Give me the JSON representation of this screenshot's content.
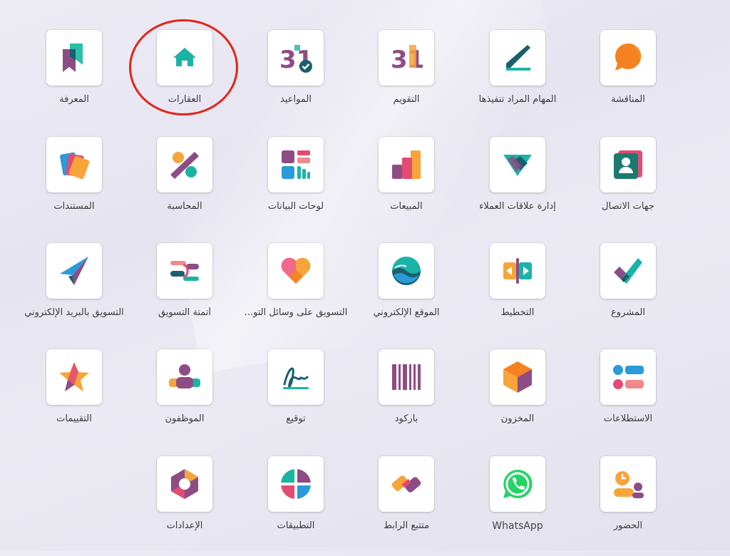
{
  "apps": {
    "knowledge": {
      "label": "المعرفة",
      "icon": "bookmark-icon"
    },
    "real_estate": {
      "label": "العقارات",
      "icon": "house-icon"
    },
    "appointments": {
      "label": "المواعيد",
      "icon": "calendar-check-icon",
      "number": "31"
    },
    "calendar": {
      "label": "التقويم",
      "icon": "calendar-icon",
      "number": "31"
    },
    "todo": {
      "label": "المهام المراد تنفيذها",
      "icon": "pen-line-icon"
    },
    "discuss": {
      "label": "المناقشة",
      "icon": "chat-bubble-icon"
    },
    "documents": {
      "label": "المستندات",
      "icon": "documents-icon"
    },
    "accounting": {
      "label": "المحاسبة",
      "icon": "percent-icon"
    },
    "dashboards": {
      "label": "لوحات البيانات",
      "icon": "dashboard-icon"
    },
    "sales": {
      "label": "المبيعات",
      "icon": "bar-chart-icon"
    },
    "crm": {
      "label": "إدارة علاقات العملاء",
      "icon": "handshake-icon"
    },
    "contacts": {
      "label": "جهات الاتصال",
      "icon": "contact-card-icon"
    },
    "email_marketing": {
      "label": "التسويق بالبريد الإلكتروني",
      "icon": "paper-plane-icon"
    },
    "marketing_automation": {
      "label": "أتمتة التسويق",
      "icon": "automation-arrows-icon"
    },
    "social_marketing": {
      "label": "التسويق على وسائل التو...",
      "icon": "heart-icon"
    },
    "website": {
      "label": "الموقع الإلكتروني",
      "icon": "globe-waves-icon"
    },
    "planning": {
      "label": "التخطيط",
      "icon": "planning-arrows-icon"
    },
    "project": {
      "label": "المشروع",
      "icon": "checkmark-icon"
    },
    "appraisals": {
      "label": "التقييمات",
      "icon": "star-icon"
    },
    "employees": {
      "label": "الموظفون",
      "icon": "people-icon"
    },
    "sign": {
      "label": "توقيع",
      "icon": "signature-icon"
    },
    "barcode": {
      "label": "باركود",
      "icon": "barcode-icon"
    },
    "inventory": {
      "label": "المخزون",
      "icon": "box-hexagon-icon"
    },
    "surveys": {
      "label": "الاستطلاعات",
      "icon": "survey-icon"
    },
    "settings": {
      "label": "الإعدادات",
      "icon": "settings-hexagon-icon"
    },
    "apps": {
      "label": "التطبيقات",
      "icon": "apps-circle-icon"
    },
    "link_tracker": {
      "label": "متتبع الرابط",
      "icon": "link-chain-icon"
    },
    "whatsapp": {
      "label": "WhatsApp",
      "icon": "whatsapp-icon"
    },
    "attendance": {
      "label": "الحضور",
      "icon": "attendance-icon"
    }
  },
  "colors": {
    "purple": "#8e4c85",
    "teal": "#1ab4a6",
    "orange": "#f7a43b",
    "highlight": "#e2231a"
  }
}
